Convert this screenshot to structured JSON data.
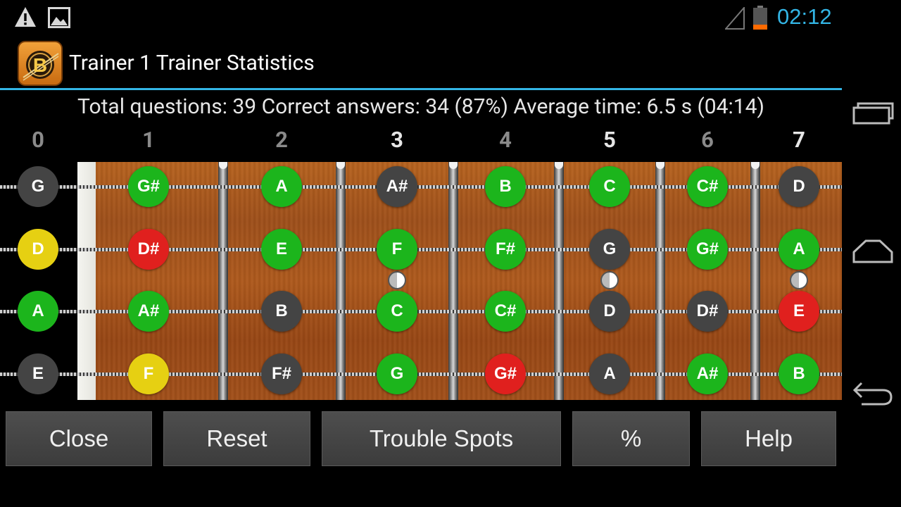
{
  "status_bar": {
    "time": "02:12",
    "icons": [
      "warning-icon",
      "image-icon",
      "signal-icon",
      "battery-icon"
    ],
    "time_color": "#33b5e5"
  },
  "action_bar": {
    "logo_letter": "B",
    "title": "Trainer 1 Trainer Statistics",
    "accent": "#33b5e5"
  },
  "stats": "Total questions: 39 Correct answers: 34 (87%) Average time: 6.5 s (04:14)",
  "frets": [
    {
      "label": "0",
      "bright": false
    },
    {
      "label": "1",
      "bright": false
    },
    {
      "label": "2",
      "bright": false
    },
    {
      "label": "3",
      "bright": true
    },
    {
      "label": "4",
      "bright": false
    },
    {
      "label": "5",
      "bright": true
    },
    {
      "label": "6",
      "bright": false
    },
    {
      "label": "7",
      "bright": true
    }
  ],
  "colors": {
    "green": "#1cb51c",
    "red": "#e0201e",
    "yellow": "#e6d012",
    "gray": "#444444"
  },
  "strings": [
    {
      "notes": [
        {
          "t": "G",
          "c": "gray"
        },
        {
          "t": "G#",
          "c": "green"
        },
        {
          "t": "A",
          "c": "green"
        },
        {
          "t": "A#",
          "c": "gray"
        },
        {
          "t": "B",
          "c": "green"
        },
        {
          "t": "C",
          "c": "green"
        },
        {
          "t": "C#",
          "c": "green"
        },
        {
          "t": "D",
          "c": "gray"
        }
      ]
    },
    {
      "notes": [
        {
          "t": "D",
          "c": "yellow"
        },
        {
          "t": "D#",
          "c": "red"
        },
        {
          "t": "E",
          "c": "green"
        },
        {
          "t": "F",
          "c": "green"
        },
        {
          "t": "F#",
          "c": "green"
        },
        {
          "t": "G",
          "c": "gray"
        },
        {
          "t": "G#",
          "c": "green"
        },
        {
          "t": "A",
          "c": "green"
        }
      ]
    },
    {
      "notes": [
        {
          "t": "A",
          "c": "green"
        },
        {
          "t": "A#",
          "c": "green"
        },
        {
          "t": "B",
          "c": "gray"
        },
        {
          "t": "C",
          "c": "green"
        },
        {
          "t": "C#",
          "c": "green"
        },
        {
          "t": "D",
          "c": "gray"
        },
        {
          "t": "D#",
          "c": "gray"
        },
        {
          "t": "E",
          "c": "red"
        }
      ]
    },
    {
      "notes": [
        {
          "t": "E",
          "c": "gray"
        },
        {
          "t": "F",
          "c": "yellow"
        },
        {
          "t": "F#",
          "c": "gray"
        },
        {
          "t": "G",
          "c": "green"
        },
        {
          "t": "G#",
          "c": "red"
        },
        {
          "t": "A",
          "c": "gray"
        },
        {
          "t": "A#",
          "c": "green"
        },
        {
          "t": "B",
          "c": "green"
        }
      ]
    }
  ],
  "inlay_frets": [
    "3",
    "5",
    "7"
  ],
  "buttons": {
    "close": "Close",
    "reset": "Reset",
    "trouble_spots": "Trouble Spots",
    "percent": "%",
    "help": "Help"
  },
  "nav": [
    "recent-apps-icon",
    "home-icon",
    "back-icon"
  ]
}
